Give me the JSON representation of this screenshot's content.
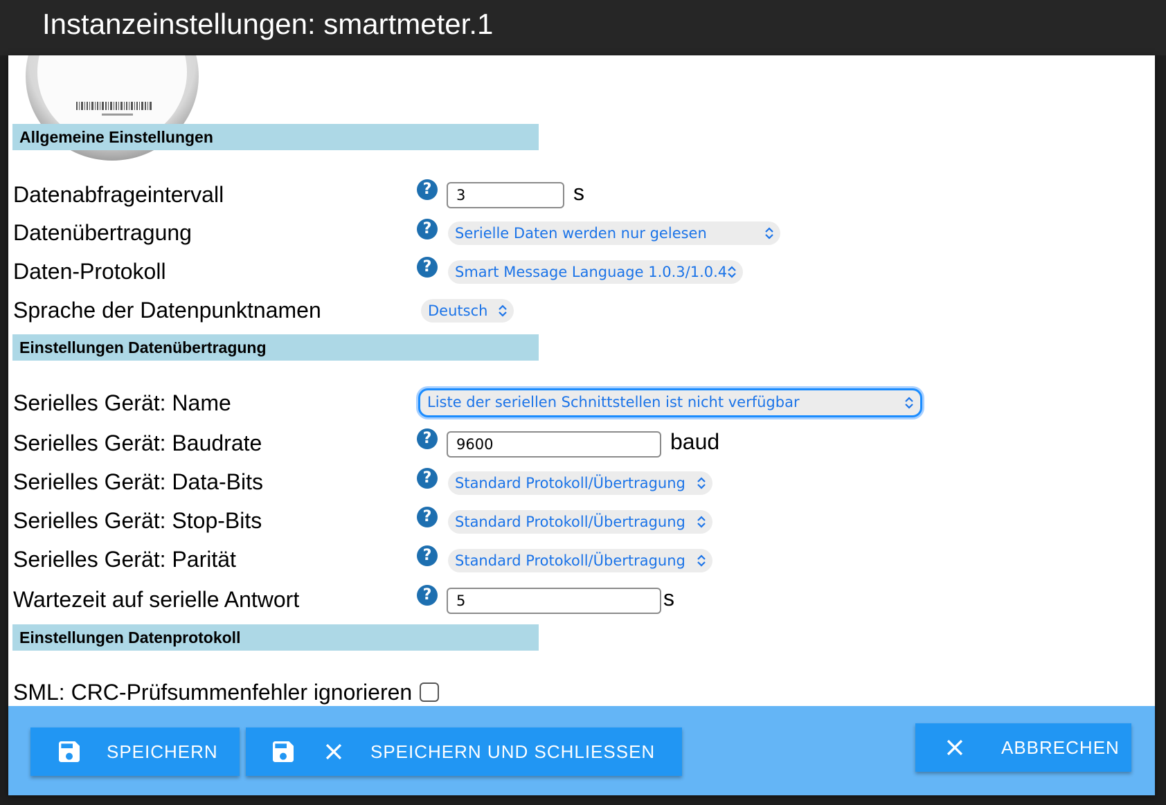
{
  "window": {
    "title": "Instanzeinstellungen: smartmeter.1"
  },
  "sections": {
    "general": "Allgemeine Einstellungen",
    "transfer": "Einstellungen Datenübertragung",
    "protocol": "Einstellungen Datenprotokoll"
  },
  "fields": {
    "interval": {
      "label": "Datenabfrageintervall",
      "value": "3",
      "unit": "s"
    },
    "transfer_mode": {
      "label": "Datenübertragung",
      "value": "Serielle Daten werden nur gelesen"
    },
    "data_protocol": {
      "label": "Daten-Protokoll",
      "value": "Smart Message Language 1.0.3/1.0.4"
    },
    "language": {
      "label": "Sprache der Datenpunktnamen",
      "value": "Deutsch"
    },
    "serial_name": {
      "label": "Serielles Gerät: Name",
      "value": "Liste der seriellen Schnittstellen ist nicht verfügbar"
    },
    "baudrate": {
      "label": "Serielles Gerät: Baudrate",
      "value": "9600",
      "unit": "baud"
    },
    "databits": {
      "label": "Serielles Gerät: Data-Bits",
      "value": "Standard Protokoll/Übertragung"
    },
    "stopbits": {
      "label": "Serielles Gerät: Stop-Bits",
      "value": "Standard Protokoll/Übertragung"
    },
    "parity": {
      "label": "Serielles Gerät: Parität",
      "value": "Standard Protokoll/Übertragung"
    },
    "response_timeout": {
      "label": "Wartezeit auf serielle Antwort",
      "value": "5",
      "unit": "s"
    },
    "crc_ignore": {
      "label": "SML: CRC-Prüfsummenfehler ignorieren",
      "checked": false
    }
  },
  "buttons": {
    "save": "SPEICHERN",
    "save_close": "SPEICHERN UND SCHLIESSEN",
    "cancel": "ABBRECHEN"
  },
  "colors": {
    "section_bg": "#add8e6",
    "footer_bg": "#64b5f6",
    "button_bg": "#2196f3",
    "select_text": "#1a73e8",
    "help_icon": "#1d6fb0"
  }
}
